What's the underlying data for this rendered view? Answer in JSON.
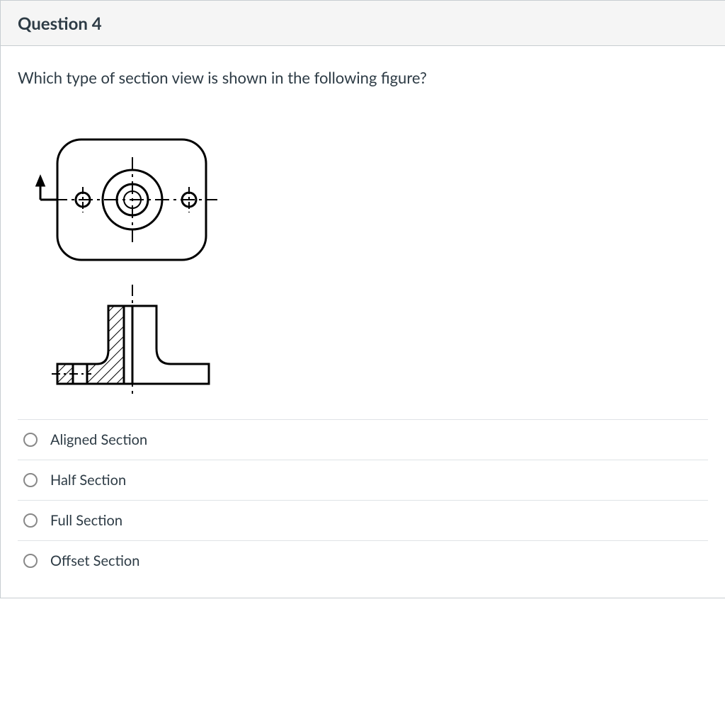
{
  "header": {
    "title": "Question 4"
  },
  "prompt": "Which type of section view is shown in the following figure?",
  "options": [
    {
      "label": "Aligned Section"
    },
    {
      "label": "Half Section"
    },
    {
      "label": "Full Section"
    },
    {
      "label": "Offset Section"
    }
  ]
}
